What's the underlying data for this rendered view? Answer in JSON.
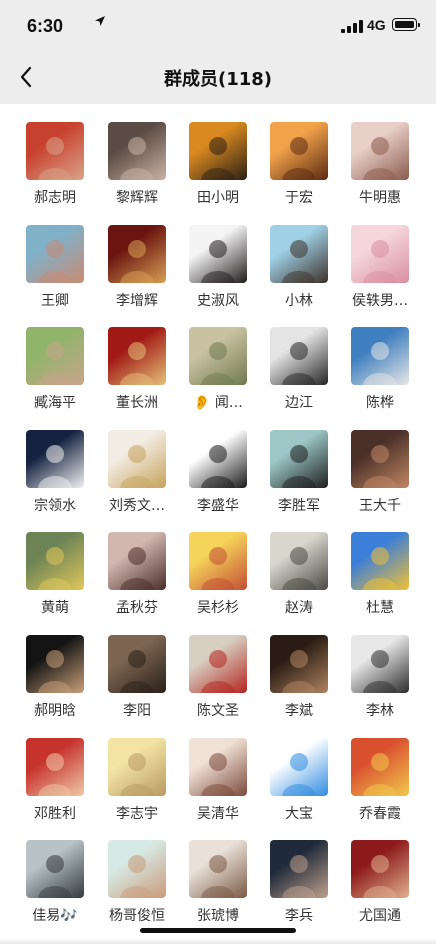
{
  "status_bar": {
    "time": "6:30",
    "network": "4G"
  },
  "header": {
    "title": "群成员(118)",
    "back_icon": "chevron-left-icon"
  },
  "members": [
    {
      "name": "郝志明",
      "colors": [
        "#c8412e",
        "#d9a38a"
      ]
    },
    {
      "name": "黎辉辉",
      "colors": [
        "#5a4b44",
        "#cbb3a5"
      ]
    },
    {
      "name": "田小明",
      "colors": [
        "#d9891f",
        "#2b2016"
      ]
    },
    {
      "name": "于宏",
      "colors": [
        "#f2a24a",
        "#5b2a12"
      ]
    },
    {
      "name": "牛明惠",
      "colors": [
        "#e8cfc8",
        "#8b5b4d"
      ]
    },
    {
      "name": "王卿",
      "colors": [
        "#7fb1c9",
        "#c98a73"
      ]
    },
    {
      "name": "李增辉",
      "colors": [
        "#6b1510",
        "#d7a055"
      ]
    },
    {
      "name": "史淑风",
      "colors": [
        "#f4f4f4",
        "#201c1c"
      ]
    },
    {
      "name": "小林",
      "colors": [
        "#9fd0e6",
        "#3d3229"
      ]
    },
    {
      "name": "侯轶男…",
      "colors": [
        "#f5d6dc",
        "#d98ea0"
      ]
    },
    {
      "name": "臧海平",
      "colors": [
        "#8fb46a",
        "#c9a48c"
      ]
    },
    {
      "name": "董长洲",
      "colors": [
        "#a11914",
        "#e6c07a"
      ]
    },
    {
      "name": "👂 闻…",
      "colors": [
        "#c9c1a0",
        "#6f7a4f"
      ]
    },
    {
      "name": "边江",
      "colors": [
        "#e4e4e4",
        "#262626"
      ]
    },
    {
      "name": "陈桦",
      "colors": [
        "#3f7fbf",
        "#e6e6e6"
      ]
    },
    {
      "name": "宗领水",
      "colors": [
        "#152240",
        "#f2f2f2"
      ]
    },
    {
      "name": "刘秀文…",
      "colors": [
        "#f3ece4",
        "#c7a35c"
      ]
    },
    {
      "name": "李盛华",
      "colors": [
        "#ffffff",
        "#1a1a1a"
      ]
    },
    {
      "name": "李胜军",
      "colors": [
        "#9cc7c6",
        "#1e1e1e"
      ]
    },
    {
      "name": "王大千",
      "colors": [
        "#4a3028",
        "#c28764"
      ]
    },
    {
      "name": "黄萌",
      "colors": [
        "#6e8456",
        "#e0c75a"
      ]
    },
    {
      "name": "孟秋芬",
      "colors": [
        "#d2b6b0",
        "#4a2e2a"
      ]
    },
    {
      "name": "吴杉杉",
      "colors": [
        "#f6d35a",
        "#c24e34"
      ]
    },
    {
      "name": "赵涛",
      "colors": [
        "#d8d6cd",
        "#4a4a44"
      ]
    },
    {
      "name": "杜慧",
      "colors": [
        "#3c7fd8",
        "#f2c033"
      ]
    },
    {
      "name": "郝明晗",
      "colors": [
        "#141414",
        "#c9a07a"
      ]
    },
    {
      "name": "李阳",
      "colors": [
        "#7d6552",
        "#2a211a"
      ]
    },
    {
      "name": "陈文圣",
      "colors": [
        "#d7cfc1",
        "#b4251f"
      ]
    },
    {
      "name": "李斌",
      "colors": [
        "#2a1c14",
        "#b08460"
      ]
    },
    {
      "name": "李林",
      "colors": [
        "#e8e8e8",
        "#2c2c2c"
      ]
    },
    {
      "name": "邓胜利",
      "colors": [
        "#c6322c",
        "#f0c9a8"
      ]
    },
    {
      "name": "李志宇",
      "colors": [
        "#f3e4a4",
        "#b89a60"
      ]
    },
    {
      "name": "吴清华",
      "colors": [
        "#f1e0d6",
        "#7a4a3a"
      ]
    },
    {
      "name": "大宝",
      "colors": [
        "#ffffff",
        "#2f8be0"
      ]
    },
    {
      "name": "乔春霞",
      "colors": [
        "#d9502f",
        "#f2c94c"
      ]
    },
    {
      "name": "佳易🎶",
      "colors": [
        "#b8c2c7",
        "#333b3f"
      ]
    },
    {
      "name": "杨哥俊恒",
      "colors": [
        "#d7e9e4",
        "#c99b7a"
      ]
    },
    {
      "name": "张琥博",
      "colors": [
        "#e9e0d8",
        "#7a5a45"
      ]
    },
    {
      "name": "李兵",
      "colors": [
        "#1f2a3a",
        "#c0a08d"
      ]
    },
    {
      "name": "尤国通",
      "colors": [
        "#8d1a1a",
        "#e0b090"
      ]
    }
  ]
}
